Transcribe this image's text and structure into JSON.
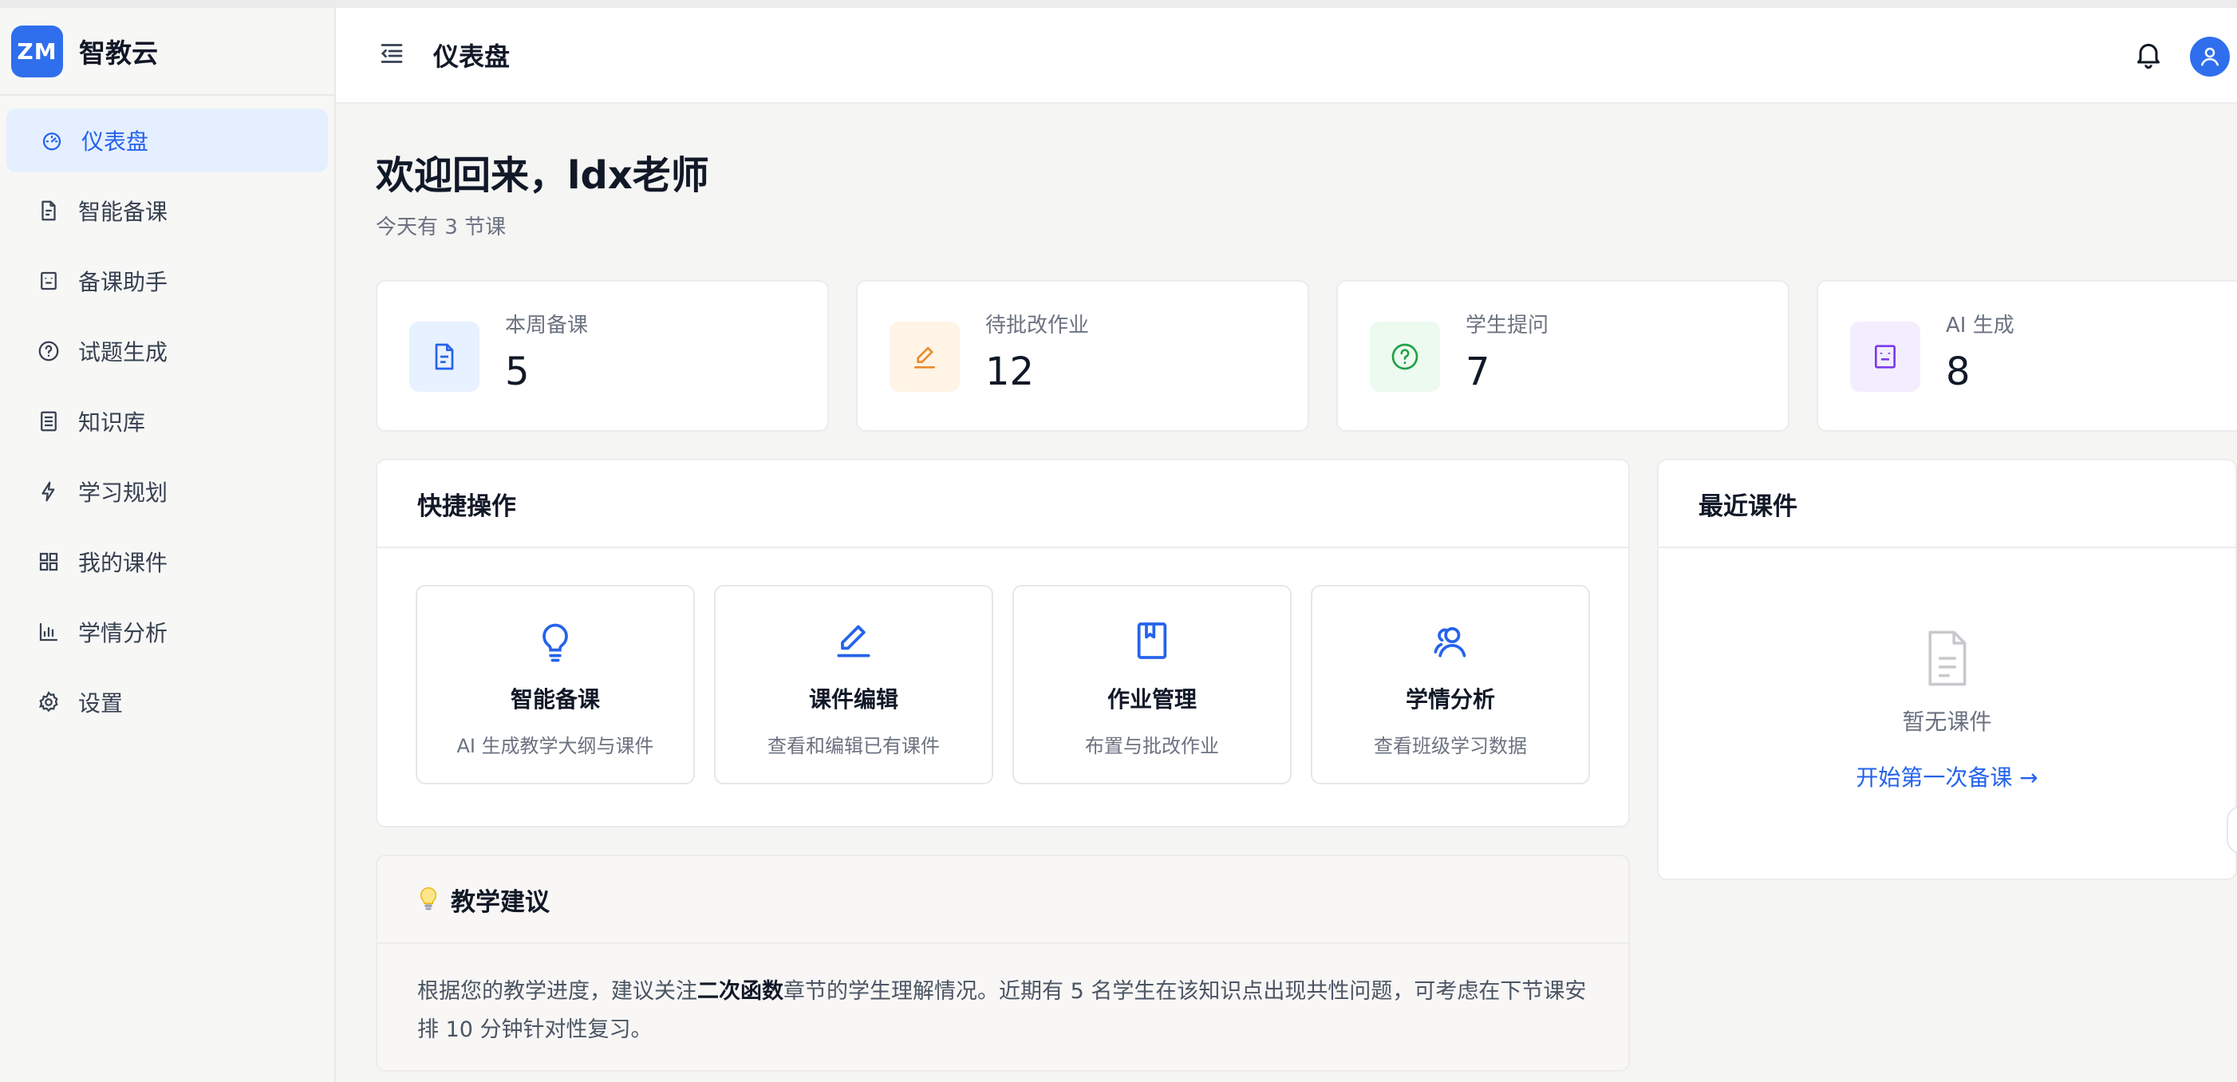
{
  "brand": {
    "logo_text": "ZM",
    "name": "智教云"
  },
  "sidebar": {
    "items": [
      {
        "label": "仪表盘",
        "icon": "gauge-icon",
        "active": true
      },
      {
        "label": "智能备课",
        "icon": "document-icon"
      },
      {
        "label": "备课助手",
        "icon": "robot-icon"
      },
      {
        "label": "试题生成",
        "icon": "question-circle-icon"
      },
      {
        "label": "知识库",
        "icon": "book-icon"
      },
      {
        "label": "学习规划",
        "icon": "lightning-icon"
      },
      {
        "label": "我的课件",
        "icon": "grid-icon"
      },
      {
        "label": "学情分析",
        "icon": "bar-chart-icon"
      },
      {
        "label": "设置",
        "icon": "gear-icon"
      }
    ]
  },
  "header": {
    "title": "仪表盘"
  },
  "welcome": {
    "title": "欢迎回来，ldx老师",
    "subtitle": "今天有 3 节课"
  },
  "stats": [
    {
      "label": "本周备课",
      "value": "5",
      "icon": "document-icon",
      "color": "#2563eb",
      "bg": "#e8f1ff"
    },
    {
      "label": "待批改作业",
      "value": "12",
      "icon": "pencil-icon",
      "color": "#ea8a2e",
      "bg": "#fff4e6"
    },
    {
      "label": "学生提问",
      "value": "7",
      "icon": "question-circle-icon",
      "color": "#22a045",
      "bg": "#ecfaef"
    },
    {
      "label": "AI 生成",
      "value": "8",
      "icon": "robot-icon",
      "color": "#7c3aed",
      "bg": "#f3eefe"
    }
  ],
  "quick_actions": {
    "title": "快捷操作",
    "items": [
      {
        "title": "智能备课",
        "desc": "AI 生成教学大纲与课件",
        "icon": "lightbulb-icon"
      },
      {
        "title": "课件编辑",
        "desc": "查看和编辑已有课件",
        "icon": "pencil-icon"
      },
      {
        "title": "作业管理",
        "desc": "布置与批改作业",
        "icon": "book-icon"
      },
      {
        "title": "学情分析",
        "desc": "查看班级学习数据",
        "icon": "users-icon"
      }
    ]
  },
  "recent": {
    "title": "最近课件",
    "empty_text": "暂无课件",
    "empty_link": "开始第一次备课 →"
  },
  "tips": {
    "title": "教学建议",
    "text_before": "根据您的教学进度，建议关注",
    "highlight": "二次函数",
    "text_after": "章节的学生理解情况。近期有 5 名学生在该知识点出现共性问题，可考虑在下节课安排 10 分钟针对性复习。"
  },
  "colors": {
    "accent": "#2563eb",
    "brand": "#2f6fed"
  }
}
